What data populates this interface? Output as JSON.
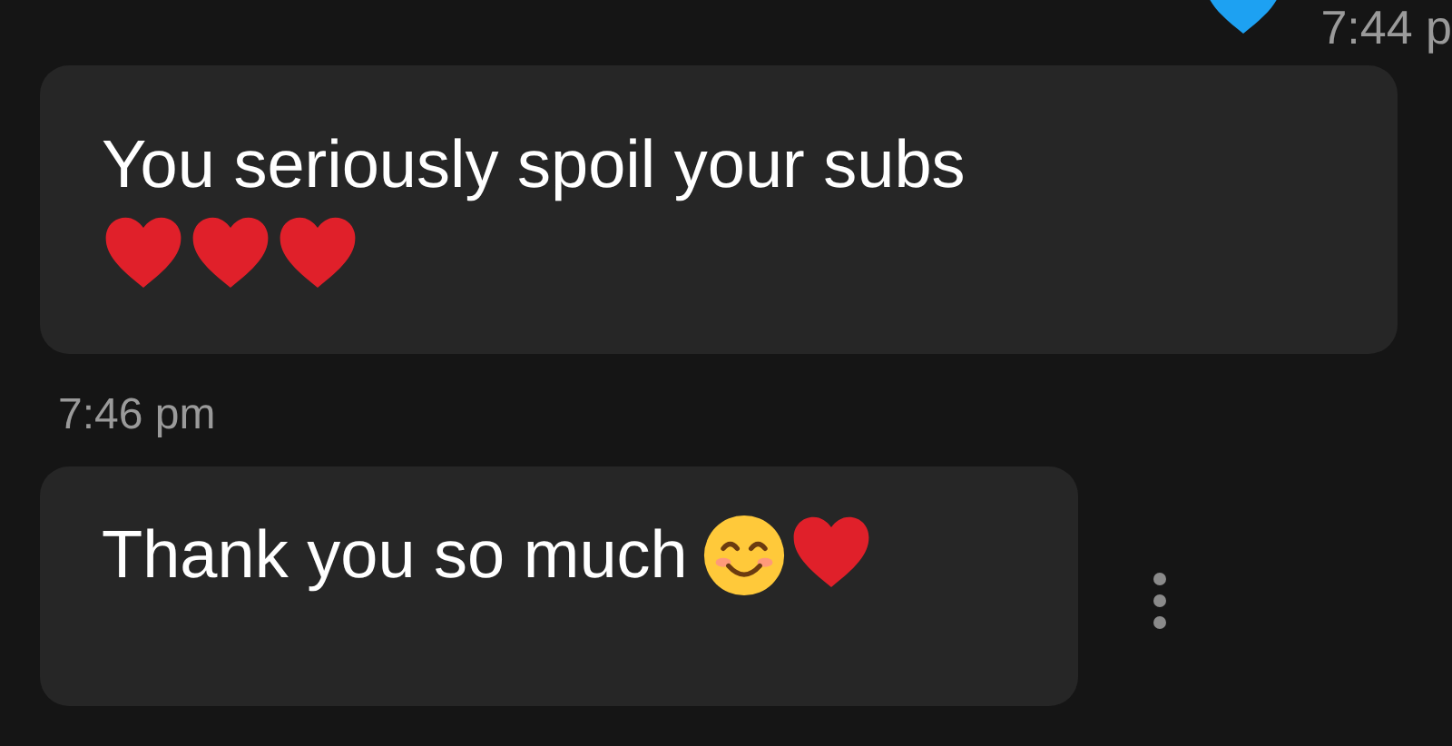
{
  "top_status": {
    "emojis": [
      {
        "kind": "heart",
        "color": "#1da1f2"
      }
    ],
    "time": "7:44 p"
  },
  "messages": [
    {
      "text": "You seriously spoil your subs",
      "emojis": [
        {
          "kind": "heart"
        },
        {
          "kind": "heart"
        },
        {
          "kind": "heart"
        }
      ],
      "inline": false
    },
    {
      "timestamp": "7:46 pm"
    },
    {
      "text": "Thank you so much",
      "emojis": [
        {
          "kind": "smiley"
        },
        {
          "kind": "heart"
        }
      ],
      "inline": true,
      "menu": true
    }
  ]
}
